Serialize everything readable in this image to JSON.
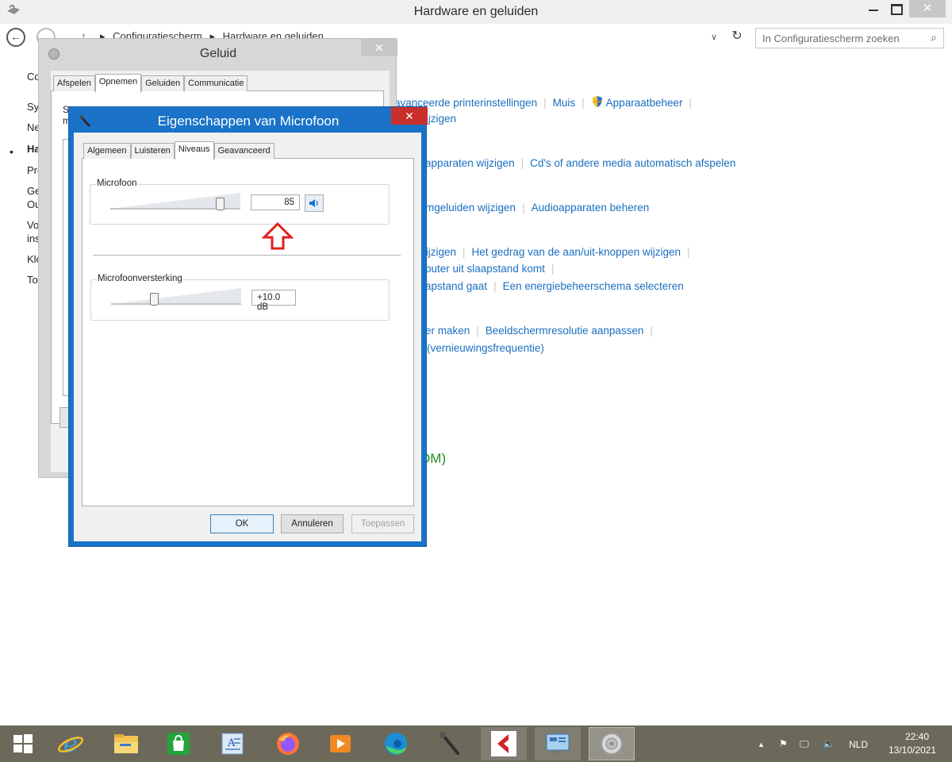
{
  "window": {
    "title": "Hardware en geluiden",
    "close_glyph": "✕"
  },
  "address": {
    "back": "←",
    "forward": "→",
    "up": "↑",
    "breadcrumb": [
      "Configuratiescherm",
      "Hardware en geluiden"
    ],
    "separator": "▸",
    "dropdown": "∨",
    "refresh": "↻",
    "search_placeholder": "In Configuratiescherm zoeken",
    "search_glyph": "⌕"
  },
  "leftnav": {
    "bullet": "•",
    "items": [
      "Co",
      "Sy",
      "Ne",
      "Ha",
      "Pro",
      "Ge",
      "Ou",
      "Vo",
      "ins",
      "Klo",
      "To"
    ]
  },
  "content": {
    "row1": [
      "avanceerde printerinstellingen",
      "Muis",
      "Apparaatbeheer"
    ],
    "row1b": "vijzigen",
    "row2": [
      "apparaten wijzigen",
      "Cd's of andere media automatisch afspelen"
    ],
    "row3": [
      "mgeluiden wijzigen",
      "Audioapparaten beheren"
    ],
    "row4": [
      "vijzigen",
      "Het gedrag van de aan/uit-knoppen wijzigen"
    ],
    "row4b": "puter uit slaapstand komt",
    "row4c": [
      "apstand gaat",
      "Een energiebeheerschema selecteren"
    ],
    "row5": [
      "er maken",
      "Beeldschermresolutie aanpassen"
    ],
    "row5b": "(vernieuwingsfrequentie)",
    "wdm": "DM)",
    "sep": "|"
  },
  "geluid": {
    "title": "Geluid",
    "close_glyph": "✕",
    "tabs": [
      "Afspelen",
      "Opnemen",
      "Geluiden",
      "Communicatie"
    ],
    "active_tab": 1,
    "text_stub": [
      "Se",
      "m"
    ]
  },
  "mic": {
    "title": "Eigenschappen van Microfoon",
    "close_glyph": "✕",
    "tabs": [
      "Algemeen",
      "Luisteren",
      "Niveaus",
      "Geavanceerd"
    ],
    "active_tab": 2,
    "levels": {
      "microphone_label": "Microfoon",
      "microphone_value": "85",
      "microphone_level": 0.85,
      "boost_label": "Microfoonversterking",
      "boost_value": "+10.0 dB",
      "boost_level": 0.333
    },
    "buttons": {
      "ok": "OK",
      "cancel": "Annuleren",
      "apply": "Toepassen"
    }
  },
  "taskbar": {
    "apps": [
      "windows-start",
      "internet-explorer",
      "file-explorer",
      "store",
      "wordpad",
      "firefox",
      "media-player",
      "edge",
      "microphone",
      "cakewalk",
      "control-panel",
      "sound"
    ],
    "tray": {
      "chevron": "▲",
      "flag": "⚑",
      "network": "🖵",
      "volume": "🔈",
      "language": "NLD",
      "time": "22:40",
      "date": "13/10/2021"
    }
  },
  "colors": {
    "accent": "#1a73c8",
    "link": "#1a6fc0",
    "close_active": "#c9302c",
    "taskbar": "#6c695a",
    "arrow": "#e0201b"
  }
}
